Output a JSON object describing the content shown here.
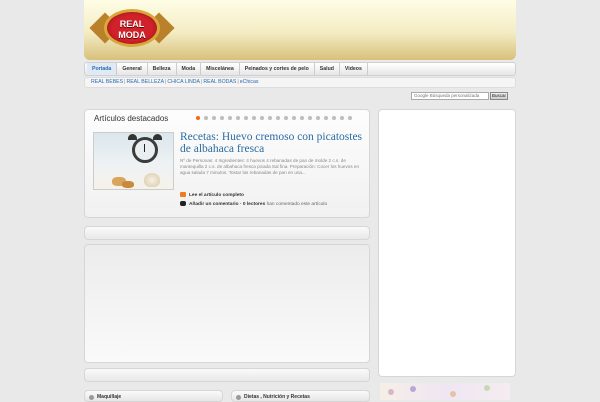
{
  "logo": {
    "line1": "REAL",
    "line2": "MODA"
  },
  "nav": {
    "items": [
      "Portada",
      "General",
      "Belleza",
      "Moda",
      "Miscelánea",
      "Peinados y cortes de pelo",
      "Salud",
      "Videos"
    ],
    "active": "Portada"
  },
  "subnav": {
    "items": [
      "REAL BEBES",
      "REAL BELLEZA",
      "CHICA LINDA",
      "REAL BODAS",
      "eChicas"
    ]
  },
  "search": {
    "placeholder": "Google Búsqueda personalizada",
    "button_label": "Buscar"
  },
  "featured": {
    "title": "Artículos destacados",
    "slides_total": 20,
    "slide_active": 1,
    "post": {
      "title": "Recetas: Huevo cremoso con picatostes de albahaca fresca",
      "excerpt": "Nº de Personas: 4 Ingredientes: 4 huevos 4 rebanadas de pan de molde 2 c.s. de mantequilla 2 c.s. de albahaca fresca picada Sal fina. Preparación: Cocer los huevos en agua salada 7 minutos. Tostar las rebanadas de pan en una...",
      "read_more": "Lee el artículo completo",
      "comment_link": "Añadir un comentario · 0 lectores",
      "comment_rest": "han comentado este artículo"
    }
  },
  "categories": [
    "Maquillaje",
    "Dietas , Nutrición y Recetas"
  ],
  "colors": {
    "accent": "#2b6ca3",
    "active_dot": "#f06a1a",
    "rss": "#f27b20"
  },
  "icons": {
    "read_more": "rss-icon",
    "comment": "comment-icon"
  }
}
